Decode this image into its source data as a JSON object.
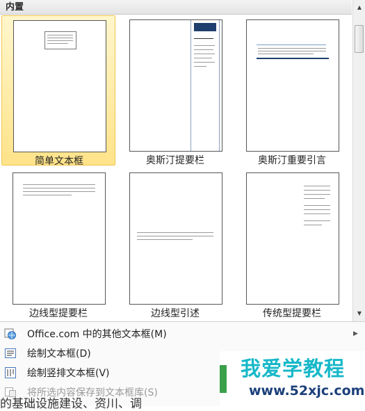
{
  "gallery": {
    "section_title": "内置",
    "items": [
      {
        "label": "简单文本框",
        "selected": true
      },
      {
        "label": "奥斯汀提要栏",
        "selected": false
      },
      {
        "label": "奥斯汀重要引言",
        "selected": false
      },
      {
        "label": "边线型提要栏",
        "selected": false
      },
      {
        "label": "边线型引述",
        "selected": false
      },
      {
        "label": "传统型提要栏",
        "selected": false
      }
    ]
  },
  "menu": {
    "items": [
      {
        "label": "Office.com 中的其他文本框(M)",
        "icon": "globe-icon",
        "enabled": true,
        "submenu": true
      },
      {
        "label": "绘制文本框(D)",
        "icon": "textbox-icon",
        "enabled": true,
        "submenu": false
      },
      {
        "label": "绘制竖排文本框(V)",
        "icon": "vertical-textbox-icon",
        "enabled": true,
        "submenu": false
      },
      {
        "label": "将所选内容保存到文本框库(S)",
        "icon": "save-to-gallery-icon",
        "enabled": false,
        "submenu": false
      }
    ]
  },
  "watermark": {
    "title": "我爱学教程",
    "url": "www.52xjc.com"
  },
  "background_text": "的基础设施建设、资川、调",
  "colors": {
    "selected_fill": "#ffe38a",
    "accent_blue": "#1f3f6e",
    "watermark_cyan": "#17b8c8"
  }
}
